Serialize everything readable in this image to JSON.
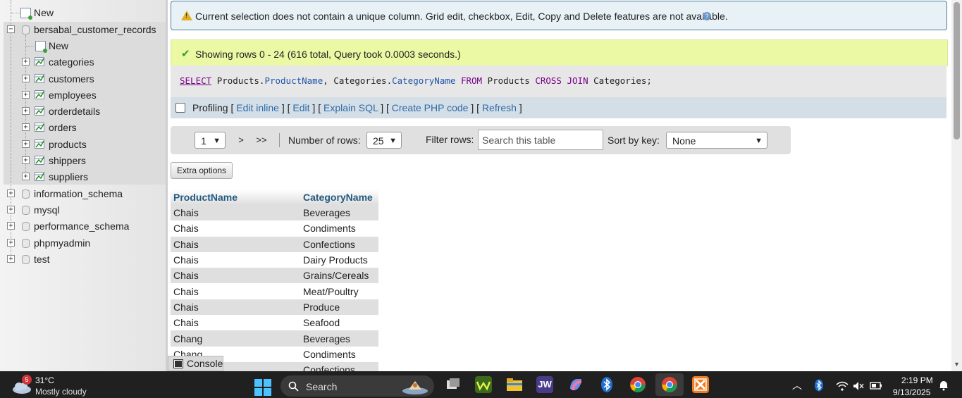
{
  "nav": {
    "db_items": [
      {
        "label": "New"
      },
      {
        "label": "bersabal_customer_records"
      },
      {
        "label": "information_schema"
      },
      {
        "label": "mysql"
      },
      {
        "label": "performance_schema"
      },
      {
        "label": "phpmyadmin"
      },
      {
        "label": "test"
      }
    ],
    "tables": [
      "New",
      "categories",
      "customers",
      "employees",
      "orderdetails",
      "orders",
      "products",
      "shippers",
      "suppliers"
    ]
  },
  "warning": {
    "text": "Current selection does not contain a unique column. Grid edit, checkbox, Edit, Copy and Delete features are not available."
  },
  "success": {
    "text": "Showing rows 0 - 24 (616 total, Query took 0.0003 seconds.)"
  },
  "sql": {
    "select": "SELECT",
    "t1": "Products",
    "c1": "ProductName",
    "t2": "Categories",
    "c2": "CategoryName",
    "from": "FROM",
    "products": "Products",
    "cross": "CROSS",
    "join": "JOIN",
    "categories": "Categories;"
  },
  "profiling": {
    "label": "Profiling",
    "links": [
      "Edit inline",
      "Edit",
      "Explain SQL",
      "Create PHP code",
      "Refresh"
    ]
  },
  "pager": {
    "page": "1",
    "next": ">",
    "last": ">>",
    "rows_label": "Number of rows:",
    "rows_value": "25",
    "filter_label": "Filter rows:",
    "filter_placeholder": "Search this table",
    "sort_label": "Sort by key:",
    "sort_value": "None"
  },
  "extra_options": "Extra options",
  "results": {
    "headers": [
      "ProductName",
      "CategoryName"
    ],
    "rows": [
      [
        "Chais",
        "Beverages"
      ],
      [
        "Chais",
        "Condiments"
      ],
      [
        "Chais",
        "Confections"
      ],
      [
        "Chais",
        "Dairy Products"
      ],
      [
        "Chais",
        "Grains/Cereals"
      ],
      [
        "Chais",
        "Meat/Poultry"
      ],
      [
        "Chais",
        "Produce"
      ],
      [
        "Chais",
        "Seafood"
      ],
      [
        "Chang",
        "Beverages"
      ],
      [
        "Chang",
        "Condiments"
      ],
      [
        "",
        "Confections"
      ]
    ]
  },
  "console": "Console",
  "taskbar": {
    "weather_badge": "5",
    "temperature": "31°C",
    "weather": "Mostly cloudy",
    "search": "Search",
    "time": "2:19 PM",
    "date": "9/13/2025",
    "apps": [
      "task-view-icon",
      "wamp-icon",
      "file-explorer-icon",
      "jw-icon",
      "copilot-icon",
      "bluetooth-icon",
      "chrome-icon",
      "chrome-profile-icon",
      "xampp-icon"
    ]
  }
}
